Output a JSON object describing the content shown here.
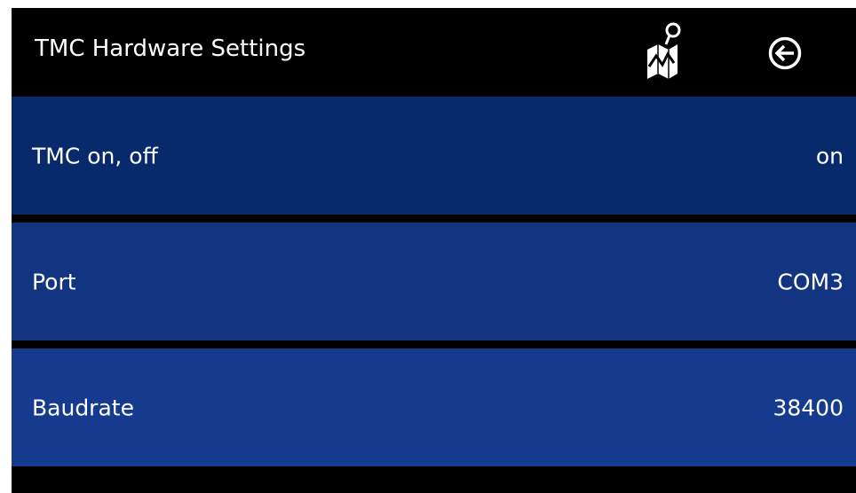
{
  "header": {
    "title": "TMC Hardware Settings",
    "map_icon": "map-pin-icon",
    "back_icon": "back-arrow-icon"
  },
  "settings": [
    {
      "label": "TMC on, off",
      "value": "on"
    },
    {
      "label": "Port",
      "value": "COM3"
    },
    {
      "label": "Baudrate",
      "value": "38400"
    }
  ],
  "colors": {
    "background": "#000000",
    "row_1": "#082a6c",
    "row_2": "#133481",
    "row_3": "#163b8e",
    "text": "#ffffff"
  }
}
